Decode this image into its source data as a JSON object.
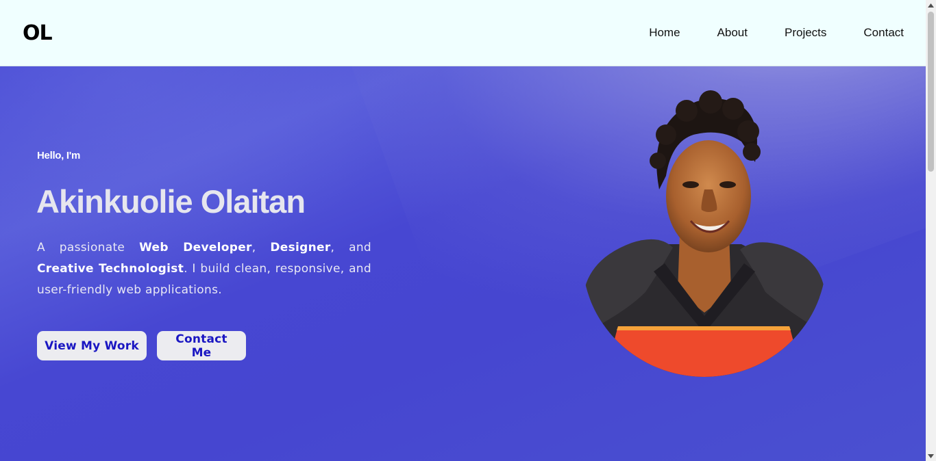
{
  "nav": {
    "logo": "OL",
    "links": [
      "Home",
      "About",
      "Projects",
      "Contact"
    ]
  },
  "hero": {
    "greeting": "Hello, I'm",
    "name": "Akinkuolie Olaitan",
    "bio": {
      "t1": "A passionate ",
      "b1": "Web Developer",
      "t2": ", ",
      "b2": "Designer",
      "t3": ", and ",
      "b3": "Creative Technologist",
      "t4": ". I build clean, responsive, and user-friendly web applications."
    },
    "buttons": {
      "work": "View My Work",
      "contact": "Contact Me"
    }
  },
  "colors": {
    "navbar_bg": "#f0ffff",
    "hero_bg": "#4646d0",
    "button_bg": "#ececf0",
    "button_text": "#1a16c2"
  },
  "icons": {
    "portrait": "profile-photo",
    "scroll_up": "arrow-up-icon",
    "scroll_down": "arrow-down-icon"
  }
}
